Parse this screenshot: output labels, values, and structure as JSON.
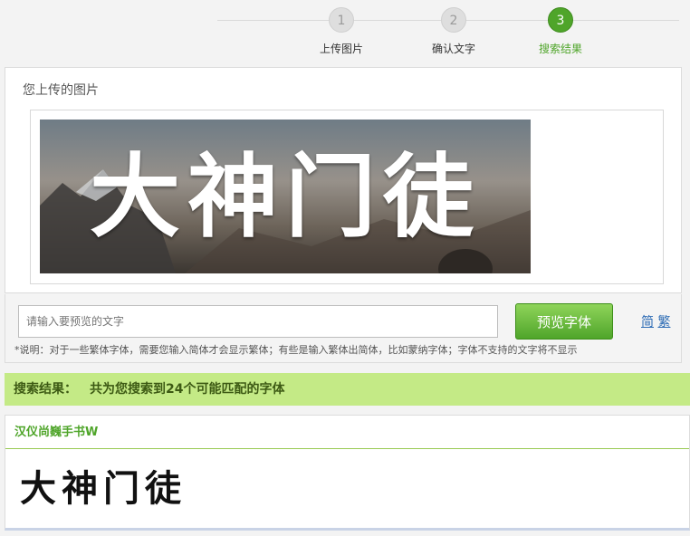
{
  "steps": [
    {
      "number": "1",
      "label": "上传图片",
      "active": false
    },
    {
      "number": "2",
      "label": "确认文字",
      "active": false
    },
    {
      "number": "3",
      "label": "搜索结果",
      "active": true
    }
  ],
  "upload": {
    "title": "您上传的图片",
    "image_text": "大神门徒"
  },
  "preview": {
    "placeholder": "请输入要预览的文字",
    "button_label": "预览字体",
    "simplified_label": "简",
    "traditional_label": "繁",
    "note": "*说明：对于一些繁体字体，需要您输入简体才会显示繁体；有些是输入繁体出简体，比如蒙纳字体；字体不支持的文字将不显示"
  },
  "results": {
    "label": "搜索结果：",
    "summary": "共为您搜索到24个可能匹配的字体"
  },
  "font_result": {
    "name": "汉仪尚巍手书W",
    "sample": "大神门徒"
  },
  "colors": {
    "accent_green": "#4fa52a",
    "results_bar": "#c4ea86",
    "link_blue": "#2f6db5"
  }
}
